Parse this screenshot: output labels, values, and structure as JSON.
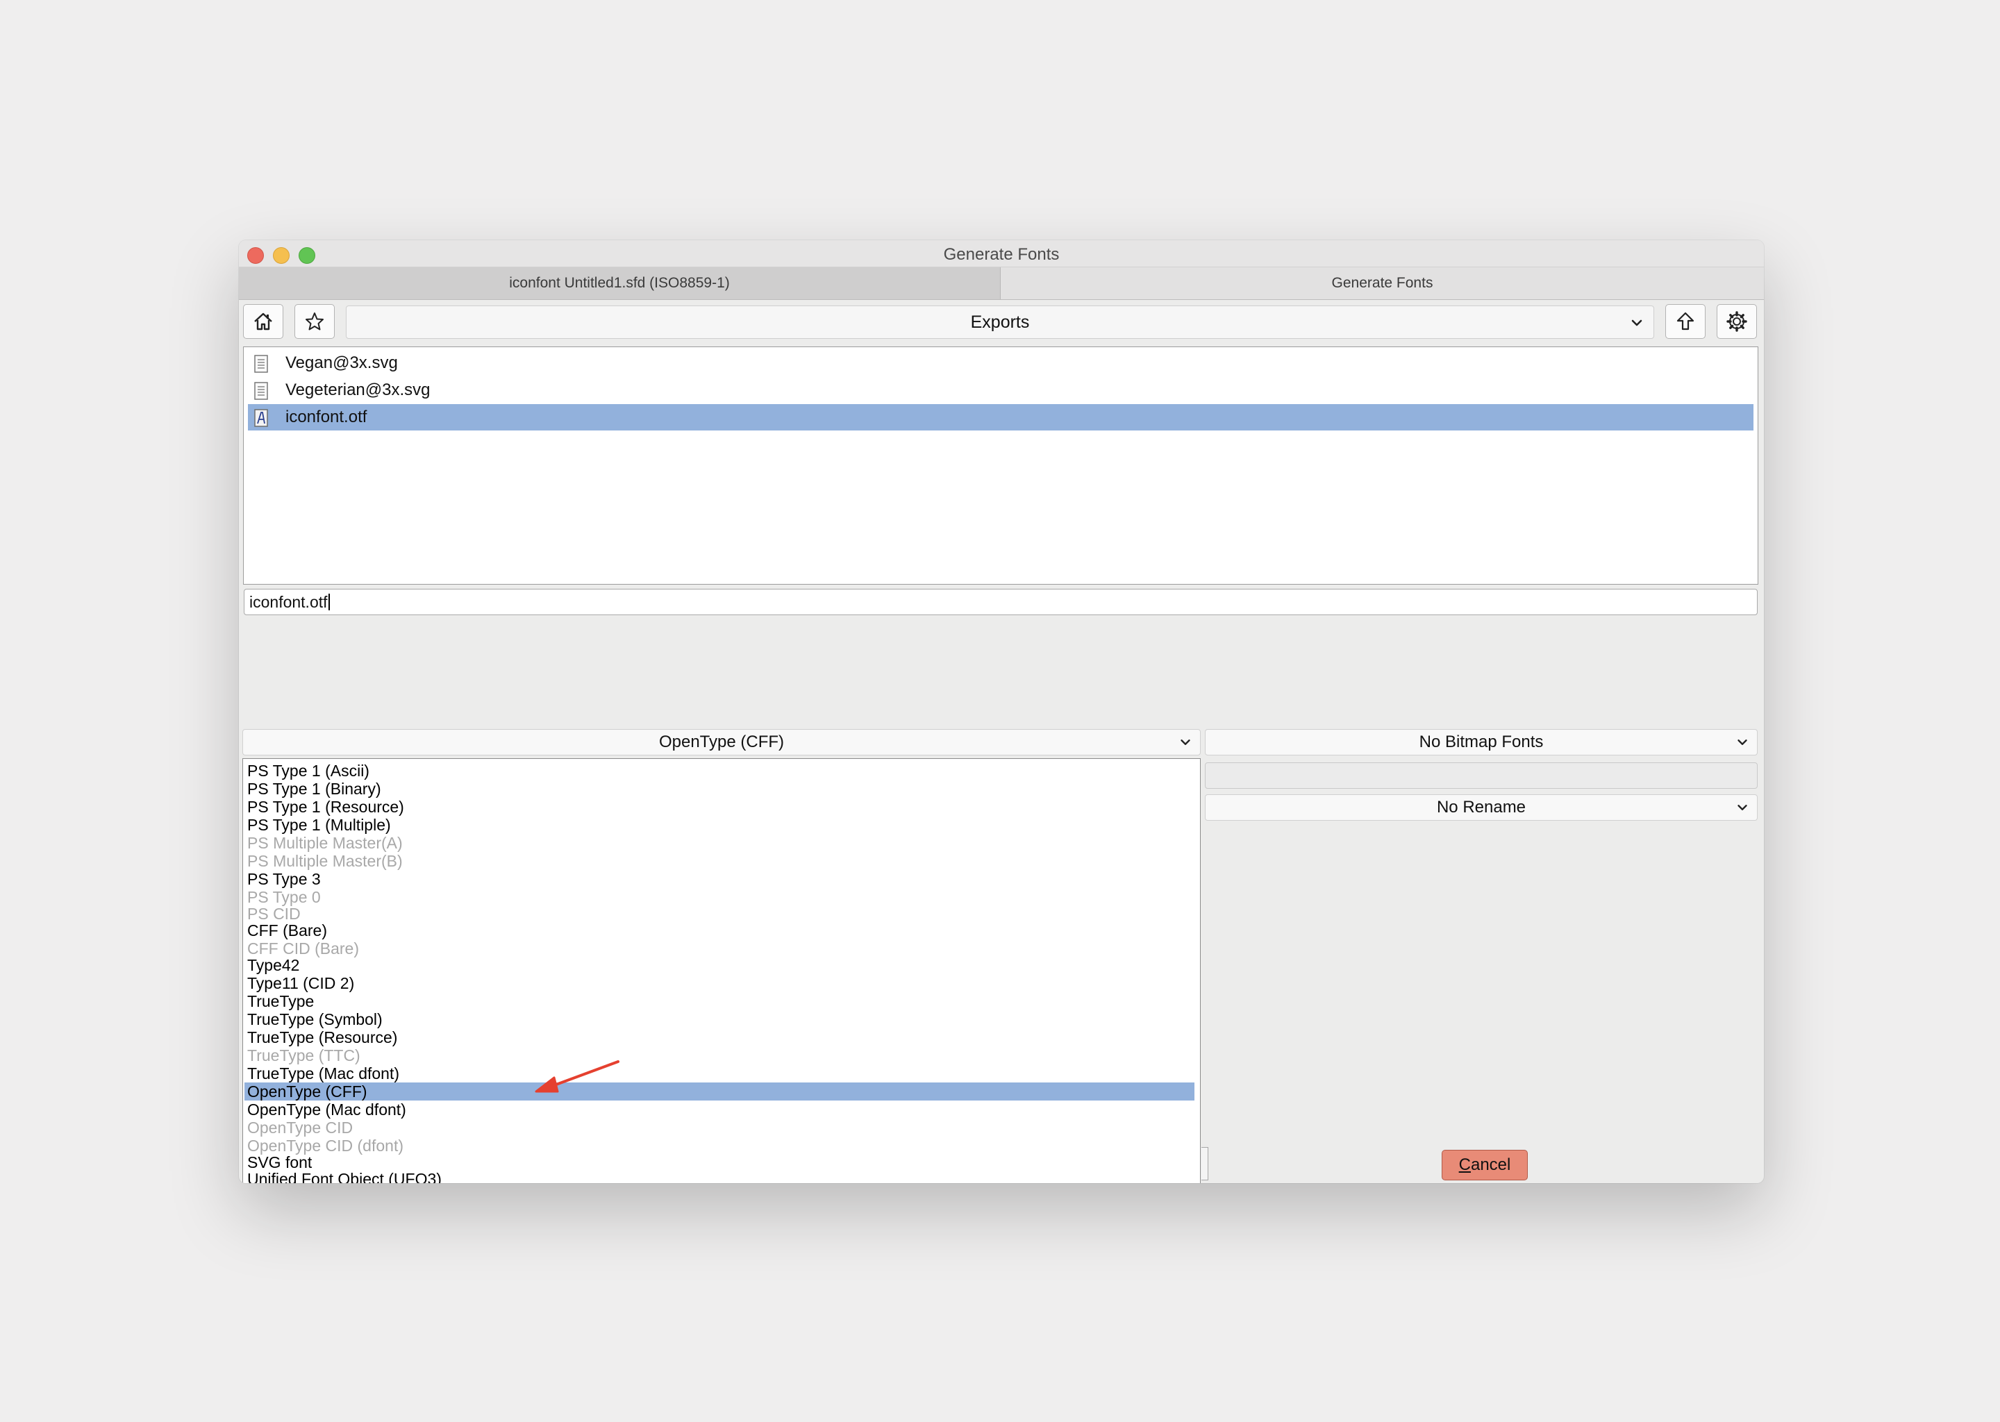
{
  "window": {
    "title": "Generate Fonts"
  },
  "tabs": [
    {
      "label": "iconfont  Untitled1.sfd (ISO8859-1)"
    },
    {
      "label": "Generate Fonts"
    }
  ],
  "toolbar": {
    "home_icon": "home-icon",
    "bookmark_icon": "star-icon",
    "directory": "Exports",
    "up_icon": "arrow-up-icon",
    "settings_icon": "gear-icon"
  },
  "files": [
    {
      "name": "Vegan@3x.svg",
      "icon": "document-icon",
      "selected": false
    },
    {
      "name": "Vegeterian@3x.svg",
      "icon": "document-icon",
      "selected": false
    },
    {
      "name": "iconfont.otf",
      "icon": "font-file-icon",
      "selected": true
    }
  ],
  "filename_input": {
    "value": "iconfont.otf"
  },
  "format_select": {
    "value": "OpenType (CFF)"
  },
  "bitmap_select": {
    "value": "No Bitmap Fonts"
  },
  "rename_select": {
    "value": "No Rename"
  },
  "format_options": [
    {
      "label": "PS Type 1 (Ascii)",
      "disabled": false,
      "selected": false
    },
    {
      "label": "PS Type 1 (Binary)",
      "disabled": false,
      "selected": false
    },
    {
      "label": "PS Type 1 (Resource)",
      "disabled": false,
      "selected": false
    },
    {
      "label": "PS Type 1 (Multiple)",
      "disabled": false,
      "selected": false
    },
    {
      "label": "PS Multiple Master(A)",
      "disabled": true,
      "selected": false
    },
    {
      "label": "PS Multiple Master(B)",
      "disabled": true,
      "selected": false
    },
    {
      "label": "PS Type 3",
      "disabled": false,
      "selected": false
    },
    {
      "label": "PS Type 0",
      "disabled": true,
      "selected": false
    },
    {
      "label": "PS CID",
      "disabled": true,
      "selected": false
    },
    {
      "label": "CFF (Bare)",
      "disabled": false,
      "selected": false
    },
    {
      "label": "CFF CID (Bare)",
      "disabled": true,
      "selected": false
    },
    {
      "label": "Type42",
      "disabled": false,
      "selected": false
    },
    {
      "label": "Type11 (CID 2)",
      "disabled": false,
      "selected": false
    },
    {
      "label": "TrueType",
      "disabled": false,
      "selected": false
    },
    {
      "label": "TrueType (Symbol)",
      "disabled": false,
      "selected": false
    },
    {
      "label": "TrueType (Resource)",
      "disabled": false,
      "selected": false
    },
    {
      "label": "TrueType (TTC)",
      "disabled": true,
      "selected": false
    },
    {
      "label": "TrueType (Mac dfont)",
      "disabled": false,
      "selected": false
    },
    {
      "label": "OpenType (CFF)",
      "disabled": false,
      "selected": true
    },
    {
      "label": "OpenType (Mac dfont)",
      "disabled": false,
      "selected": false
    },
    {
      "label": "OpenType CID",
      "disabled": true,
      "selected": false
    },
    {
      "label": "OpenType CID (dfont)",
      "disabled": true,
      "selected": false
    },
    {
      "label": "SVG font",
      "disabled": false,
      "selected": false
    },
    {
      "label": "Unified Font Object (UFO3)",
      "disabled": false,
      "selected": false
    }
  ],
  "buttons": {
    "cancel_label": "Cancel",
    "cancel_mnemonic": "C",
    "cancel_rest": "ancel"
  },
  "colors": {
    "selection": "#92b1dc",
    "cancel_button": "#e88b77",
    "annotation_arrow": "#e5402f"
  }
}
